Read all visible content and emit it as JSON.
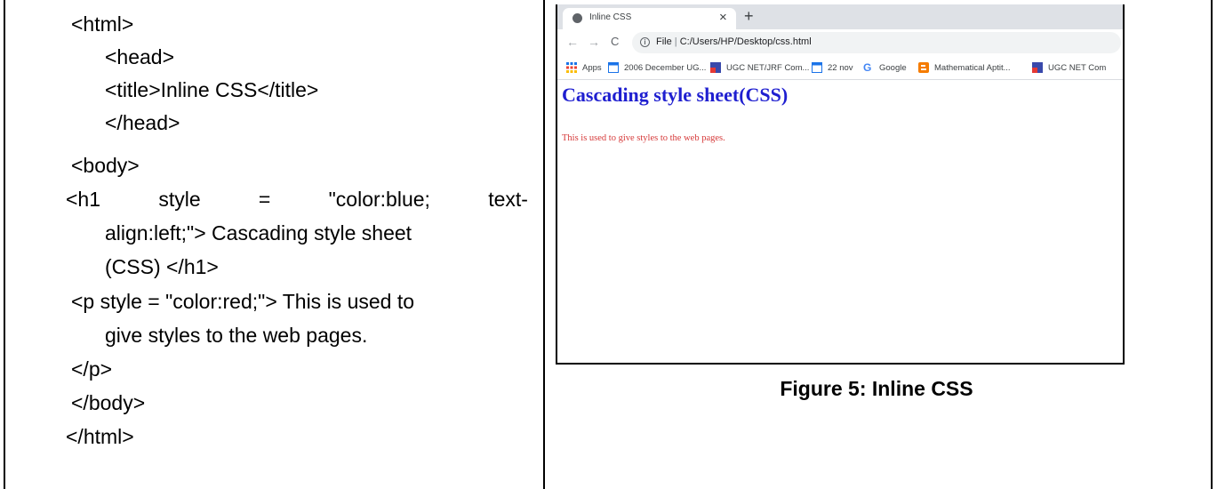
{
  "code": {
    "l1": "<html>",
    "l2": "<head>",
    "l3": "<title>Inline CSS</title>",
    "l4": "</head>",
    "l5": "<body>",
    "l6": [
      "<h1",
      "style",
      "=",
      "\"color:blue;",
      "text-"
    ],
    "l7": "align:left;\"> Cascading style sheet",
    "l8": "(CSS) </h1>",
    "l9": "<p style = \"color:red;\"> This is used to",
    "l10": "give styles to the web pages.",
    "l11": "</p>",
    "l12": "</body>",
    "l13": "</html>"
  },
  "browser": {
    "tab_title": "Inline CSS",
    "tab_close": "×",
    "new_tab": "+",
    "back": "←",
    "forward": "→",
    "reload": "C",
    "scheme": "File",
    "separator": "|",
    "url": "C:/Users/HP/Desktop/css.html",
    "bookmarks": [
      {
        "label": "Apps",
        "icon": "apps-grid-icon"
      },
      {
        "label": "2006 December UG...",
        "icon": "calendar-icon",
        "color": "#1a73e8"
      },
      {
        "label": "UGC NET/JRF Com...",
        "icon": "site-favicon",
        "color": "#3949ab"
      },
      {
        "label": "22 nov",
        "icon": "calendar-icon",
        "color": "#1a73e8"
      },
      {
        "label": "Google",
        "icon": "google-icon"
      },
      {
        "label": "Mathematical Aptit...",
        "icon": "blogger-icon",
        "color": "#f57c00"
      },
      {
        "label": "UGC NET Com",
        "icon": "site-favicon",
        "color": "#3949ab"
      }
    ]
  },
  "rendered_page": {
    "heading": "Cascading style sheet(CSS)",
    "paragraph": "This is used to give styles to the web pages.",
    "heading_color": "#1f1fd0",
    "paragraph_color": "#d63a3a"
  },
  "caption": "Figure 5: Inline CSS"
}
